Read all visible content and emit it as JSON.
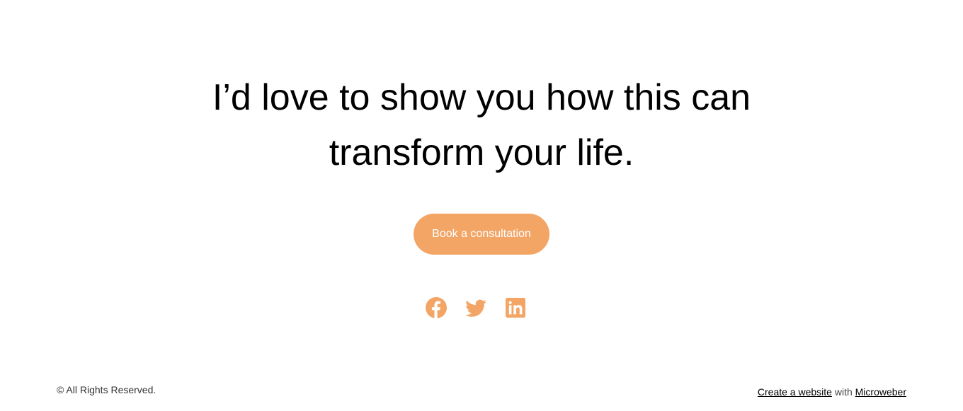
{
  "hero": {
    "headline_line1": "I’d love to show you how this can",
    "headline_line2": "transform your life.",
    "cta_label": "Book a consultation"
  },
  "social": {
    "links": [
      {
        "icon": "facebook-icon"
      },
      {
        "icon": "twitter-icon"
      },
      {
        "icon": "linkedin-icon"
      }
    ]
  },
  "footer": {
    "copyright": "© All Rights Reserved.",
    "credit_link": "Create a website",
    "credit_with": "with",
    "credit_brand": "Microweber"
  },
  "colors": {
    "accent": "#f3a566",
    "text": "#000000",
    "background": "#ffffff"
  }
}
